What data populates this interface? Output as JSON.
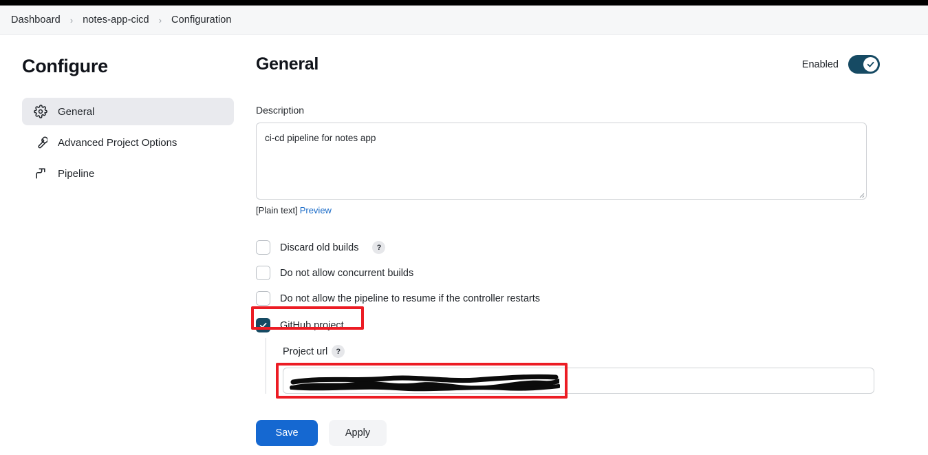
{
  "breadcrumb": {
    "separator": "›",
    "items": [
      {
        "label": "Dashboard"
      },
      {
        "label": "notes-app-cicd"
      },
      {
        "label": "Configuration"
      }
    ]
  },
  "sidebar": {
    "title": "Configure",
    "items": [
      {
        "label": "General",
        "icon": "gear-icon",
        "active": true
      },
      {
        "label": "Advanced Project Options",
        "icon": "wrench-icon",
        "active": false
      },
      {
        "label": "Pipeline",
        "icon": "pipeline-icon",
        "active": false
      }
    ]
  },
  "main": {
    "title": "General",
    "enabled": {
      "label": "Enabled",
      "state": "on",
      "color": "#164a63"
    },
    "description": {
      "label": "Description",
      "value": "ci-cd pipeline for notes app",
      "placeholder": "",
      "format_note": "[Plain text]",
      "preview_link": "Preview",
      "preview_link_color": "#1769c7"
    },
    "checkboxes": [
      {
        "label": "Discard old builds",
        "checked": false,
        "help": "?"
      },
      {
        "label": "Do not allow concurrent builds",
        "checked": false,
        "help": ""
      },
      {
        "label": "Do not allow the pipeline to resume if the controller restarts",
        "checked": false,
        "help": ""
      },
      {
        "label": "GitHub project",
        "checked": true,
        "help": ""
      }
    ],
    "github_project": {
      "url_label": "Project url",
      "url_help": "?",
      "url_value": "",
      "url_redacted": true
    }
  },
  "footer": {
    "save_label": "Save",
    "apply_label": "Apply",
    "save_color": "#1568d1"
  },
  "annotations": {
    "highlight_color": "#ec1c24",
    "boxes": [
      {
        "name": "github-project-checkbox-highlight"
      },
      {
        "name": "project-url-input-highlight"
      }
    ]
  }
}
